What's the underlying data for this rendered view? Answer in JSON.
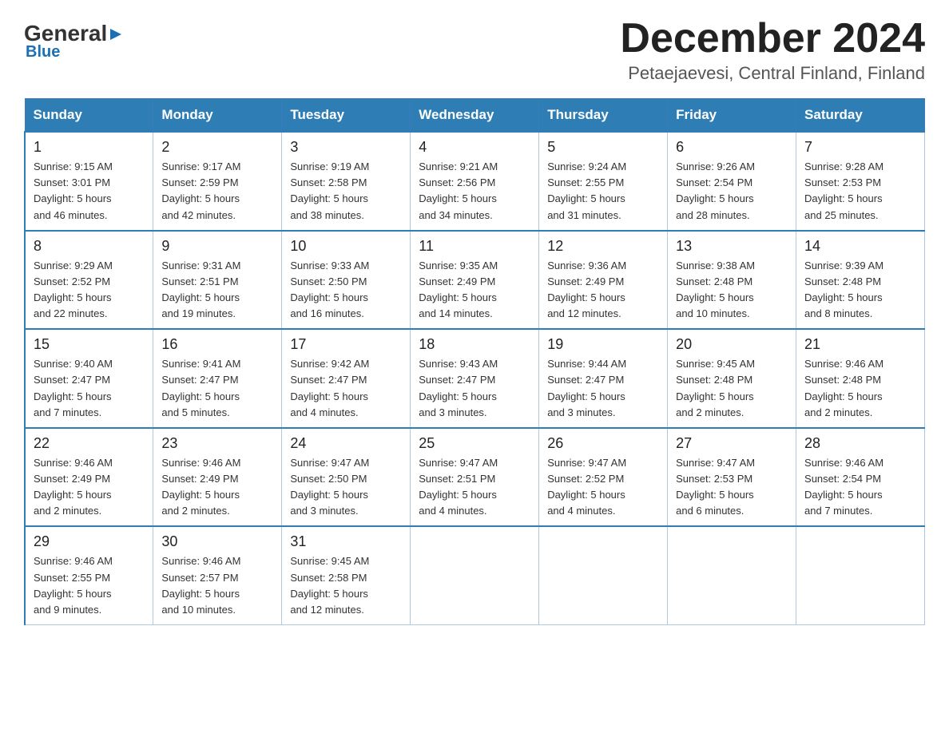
{
  "header": {
    "logo_general": "General",
    "logo_blue": "Blue",
    "title": "December 2024",
    "subtitle": "Petaejaevesi, Central Finland, Finland"
  },
  "weekdays": [
    "Sunday",
    "Monday",
    "Tuesday",
    "Wednesday",
    "Thursday",
    "Friday",
    "Saturday"
  ],
  "weeks": [
    [
      {
        "day": "1",
        "info": "Sunrise: 9:15 AM\nSunset: 3:01 PM\nDaylight: 5 hours\nand 46 minutes."
      },
      {
        "day": "2",
        "info": "Sunrise: 9:17 AM\nSunset: 2:59 PM\nDaylight: 5 hours\nand 42 minutes."
      },
      {
        "day": "3",
        "info": "Sunrise: 9:19 AM\nSunset: 2:58 PM\nDaylight: 5 hours\nand 38 minutes."
      },
      {
        "day": "4",
        "info": "Sunrise: 9:21 AM\nSunset: 2:56 PM\nDaylight: 5 hours\nand 34 minutes."
      },
      {
        "day": "5",
        "info": "Sunrise: 9:24 AM\nSunset: 2:55 PM\nDaylight: 5 hours\nand 31 minutes."
      },
      {
        "day": "6",
        "info": "Sunrise: 9:26 AM\nSunset: 2:54 PM\nDaylight: 5 hours\nand 28 minutes."
      },
      {
        "day": "7",
        "info": "Sunrise: 9:28 AM\nSunset: 2:53 PM\nDaylight: 5 hours\nand 25 minutes."
      }
    ],
    [
      {
        "day": "8",
        "info": "Sunrise: 9:29 AM\nSunset: 2:52 PM\nDaylight: 5 hours\nand 22 minutes."
      },
      {
        "day": "9",
        "info": "Sunrise: 9:31 AM\nSunset: 2:51 PM\nDaylight: 5 hours\nand 19 minutes."
      },
      {
        "day": "10",
        "info": "Sunrise: 9:33 AM\nSunset: 2:50 PM\nDaylight: 5 hours\nand 16 minutes."
      },
      {
        "day": "11",
        "info": "Sunrise: 9:35 AM\nSunset: 2:49 PM\nDaylight: 5 hours\nand 14 minutes."
      },
      {
        "day": "12",
        "info": "Sunrise: 9:36 AM\nSunset: 2:49 PM\nDaylight: 5 hours\nand 12 minutes."
      },
      {
        "day": "13",
        "info": "Sunrise: 9:38 AM\nSunset: 2:48 PM\nDaylight: 5 hours\nand 10 minutes."
      },
      {
        "day": "14",
        "info": "Sunrise: 9:39 AM\nSunset: 2:48 PM\nDaylight: 5 hours\nand 8 minutes."
      }
    ],
    [
      {
        "day": "15",
        "info": "Sunrise: 9:40 AM\nSunset: 2:47 PM\nDaylight: 5 hours\nand 7 minutes."
      },
      {
        "day": "16",
        "info": "Sunrise: 9:41 AM\nSunset: 2:47 PM\nDaylight: 5 hours\nand 5 minutes."
      },
      {
        "day": "17",
        "info": "Sunrise: 9:42 AM\nSunset: 2:47 PM\nDaylight: 5 hours\nand 4 minutes."
      },
      {
        "day": "18",
        "info": "Sunrise: 9:43 AM\nSunset: 2:47 PM\nDaylight: 5 hours\nand 3 minutes."
      },
      {
        "day": "19",
        "info": "Sunrise: 9:44 AM\nSunset: 2:47 PM\nDaylight: 5 hours\nand 3 minutes."
      },
      {
        "day": "20",
        "info": "Sunrise: 9:45 AM\nSunset: 2:48 PM\nDaylight: 5 hours\nand 2 minutes."
      },
      {
        "day": "21",
        "info": "Sunrise: 9:46 AM\nSunset: 2:48 PM\nDaylight: 5 hours\nand 2 minutes."
      }
    ],
    [
      {
        "day": "22",
        "info": "Sunrise: 9:46 AM\nSunset: 2:49 PM\nDaylight: 5 hours\nand 2 minutes."
      },
      {
        "day": "23",
        "info": "Sunrise: 9:46 AM\nSunset: 2:49 PM\nDaylight: 5 hours\nand 2 minutes."
      },
      {
        "day": "24",
        "info": "Sunrise: 9:47 AM\nSunset: 2:50 PM\nDaylight: 5 hours\nand 3 minutes."
      },
      {
        "day": "25",
        "info": "Sunrise: 9:47 AM\nSunset: 2:51 PM\nDaylight: 5 hours\nand 4 minutes."
      },
      {
        "day": "26",
        "info": "Sunrise: 9:47 AM\nSunset: 2:52 PM\nDaylight: 5 hours\nand 4 minutes."
      },
      {
        "day": "27",
        "info": "Sunrise: 9:47 AM\nSunset: 2:53 PM\nDaylight: 5 hours\nand 6 minutes."
      },
      {
        "day": "28",
        "info": "Sunrise: 9:46 AM\nSunset: 2:54 PM\nDaylight: 5 hours\nand 7 minutes."
      }
    ],
    [
      {
        "day": "29",
        "info": "Sunrise: 9:46 AM\nSunset: 2:55 PM\nDaylight: 5 hours\nand 9 minutes."
      },
      {
        "day": "30",
        "info": "Sunrise: 9:46 AM\nSunset: 2:57 PM\nDaylight: 5 hours\nand 10 minutes."
      },
      {
        "day": "31",
        "info": "Sunrise: 9:45 AM\nSunset: 2:58 PM\nDaylight: 5 hours\nand 12 minutes."
      },
      {
        "day": "",
        "info": ""
      },
      {
        "day": "",
        "info": ""
      },
      {
        "day": "",
        "info": ""
      },
      {
        "day": "",
        "info": ""
      }
    ]
  ]
}
